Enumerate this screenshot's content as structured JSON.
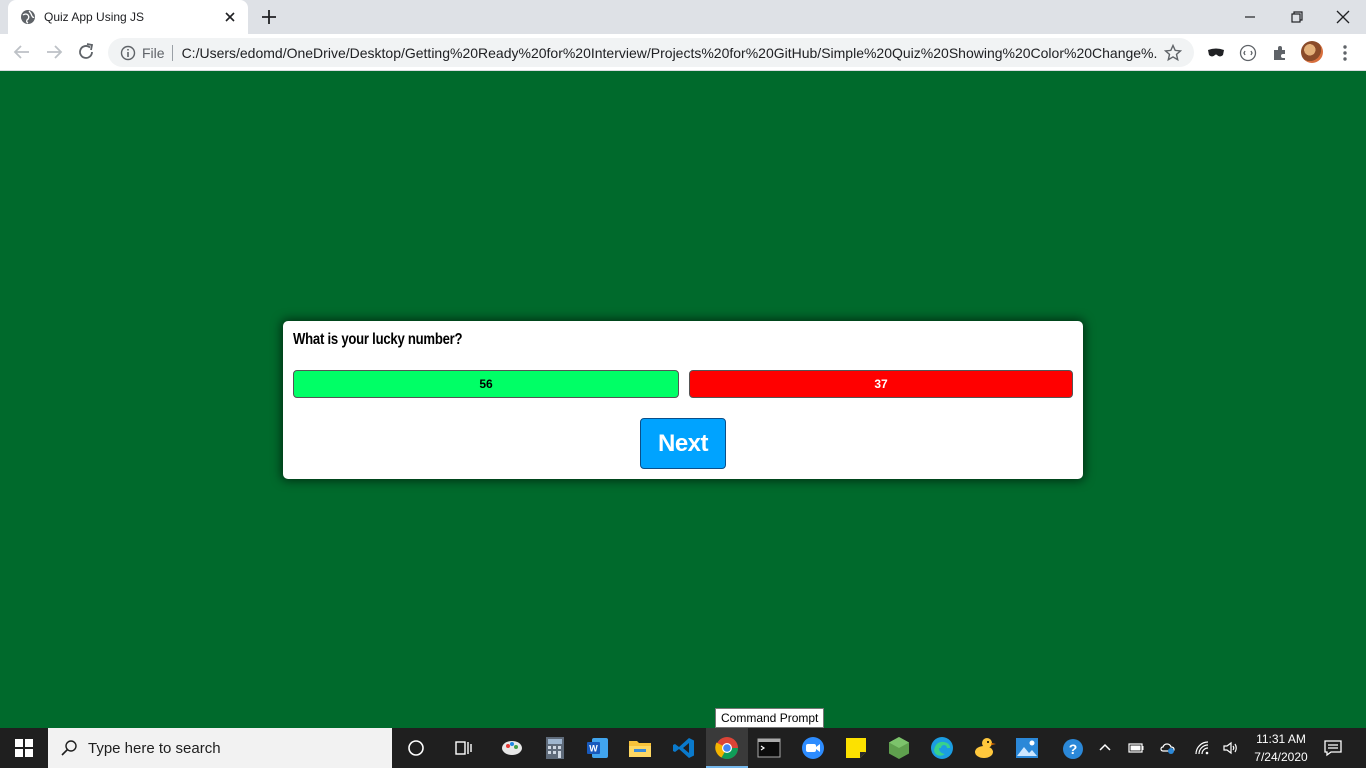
{
  "browser": {
    "tab_title": "Quiz App Using JS",
    "file_label": "File",
    "url": "C:/Users/edomd/OneDrive/Desktop/Getting%20Ready%20for%20Interview/Projects%20for%20GitHub/Simple%20Quiz%20Showing%20Color%20Change%..."
  },
  "quiz": {
    "question": "What is your lucky number?",
    "answers": [
      {
        "label": "56",
        "state": "correct",
        "color": "#00ff66"
      },
      {
        "label": "37",
        "state": "wrong",
        "color": "#ff0000"
      }
    ],
    "next_label": "Next",
    "background_color": "#006a2c",
    "next_color": "#00a3ff"
  },
  "tooltip": {
    "text": "Command Prompt"
  },
  "taskbar": {
    "search_placeholder": "Type here to search",
    "time": "11:31 AM",
    "date": "7/24/2020",
    "apps": [
      "cortana-icon",
      "task-view-icon",
      "paint-icon",
      "calculator-icon",
      "word-icon",
      "file-explorer-icon",
      "vscode-icon",
      "chrome-icon",
      "command-prompt-icon",
      "zoom-icon",
      "sticky-notes-icon",
      "nodejs-icon",
      "edge-icon",
      "duck-icon",
      "photos-icon"
    ]
  }
}
